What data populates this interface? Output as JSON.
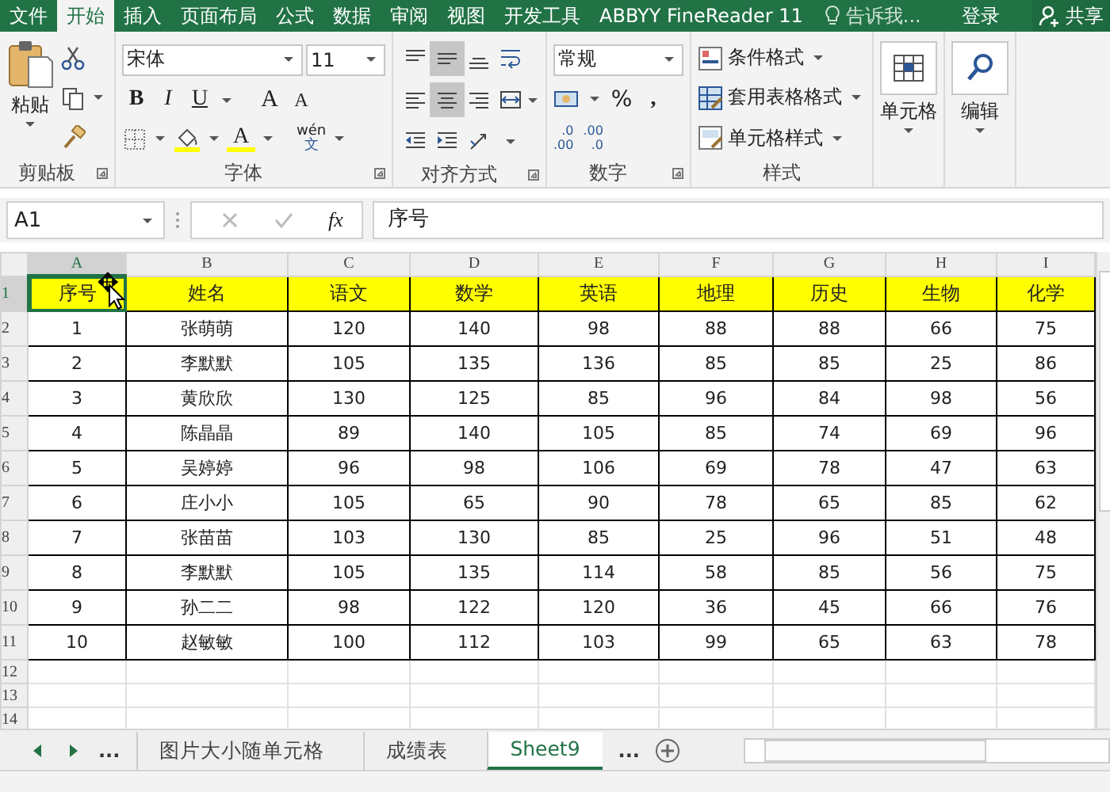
{
  "ribbon_tabs": [
    {
      "label": "文件",
      "selected": false
    },
    {
      "label": "开始",
      "selected": true
    },
    {
      "label": "插入",
      "selected": false
    },
    {
      "label": "页面布局",
      "selected": false
    },
    {
      "label": "公式",
      "selected": false
    },
    {
      "label": "数据",
      "selected": false
    },
    {
      "label": "审阅",
      "selected": false
    },
    {
      "label": "视图",
      "selected": false
    },
    {
      "label": "开发工具",
      "selected": false
    },
    {
      "label": "ABBYY FineReader 11",
      "selected": false
    }
  ],
  "tell_me": {
    "placeholder": "告诉我..."
  },
  "sign_in": "登录",
  "share": "共享",
  "ribbon": {
    "groups": [
      {
        "kind": "clipboard",
        "label": "剪贴板",
        "paste": "粘贴"
      },
      {
        "kind": "font",
        "label": "字体",
        "font_name": "宋体",
        "font_size": "11",
        "bold": "B",
        "italic": "I",
        "underline": "U",
        "grow": "A",
        "shrink": "A",
        "font_color": "A",
        "phonetic": "wén",
        "phonetic_char": "文"
      },
      {
        "kind": "alignment",
        "label": "对齐方式",
        "buttons": [
          {
            "kind": "top",
            "selected": false
          },
          {
            "kind": "middle",
            "selected": true
          },
          {
            "kind": "bottom",
            "selected": false
          },
          {
            "kind": "wrap",
            "selected": false
          },
          {
            "kind": "left",
            "selected": false
          },
          {
            "kind": "center",
            "selected": true
          },
          {
            "kind": "right",
            "selected": false
          },
          {
            "kind": "merge",
            "selected": false
          },
          {
            "kind": "outdent",
            "selected": false
          },
          {
            "kind": "indent",
            "selected": false
          },
          {
            "kind": "orientation",
            "selected": false
          }
        ]
      },
      {
        "kind": "number",
        "label": "数字",
        "format": "常规",
        "percent": "%",
        "comma": ",",
        "increase_decimal": [
          ".0",
          ".00"
        ],
        "decrease_decimal": [
          ".00",
          ".0"
        ]
      },
      {
        "kind": "styles",
        "label": "样式",
        "items": [
          "条件格式",
          "套用表格格式",
          "单元格样式"
        ]
      },
      {
        "kind": "cells",
        "button": "单元格"
      },
      {
        "kind": "editing",
        "button": "编辑"
      }
    ]
  },
  "formula_bar": {
    "name_box": "A1",
    "fx": "fx",
    "value": "序号"
  },
  "sheet": {
    "columns": [
      {
        "label": "A",
        "selected": true
      },
      {
        "label": "B",
        "selected": false
      },
      {
        "label": "C",
        "selected": false
      },
      {
        "label": "D",
        "selected": false
      },
      {
        "label": "E",
        "selected": false
      },
      {
        "label": "F",
        "selected": false
      },
      {
        "label": "G",
        "selected": false
      },
      {
        "label": "H",
        "selected": false
      },
      {
        "label": "I",
        "selected": false
      }
    ],
    "rows": [
      {
        "number": "1",
        "kind": "header",
        "selected": true,
        "cells": [
          "序号",
          "姓名",
          "语文",
          "数学",
          "英语",
          "地理",
          "历史",
          "生物",
          "化学"
        ]
      },
      {
        "number": "2",
        "kind": "data",
        "selected": false,
        "cells": [
          "1",
          "张萌萌",
          "120",
          "140",
          "98",
          "88",
          "88",
          "66",
          "75"
        ]
      },
      {
        "number": "3",
        "kind": "data",
        "selected": false,
        "cells": [
          "2",
          "李默默",
          "105",
          "135",
          "136",
          "85",
          "85",
          "25",
          "86"
        ]
      },
      {
        "number": "4",
        "kind": "data",
        "selected": false,
        "cells": [
          "3",
          "黄欣欣",
          "130",
          "125",
          "85",
          "96",
          "84",
          "98",
          "56"
        ]
      },
      {
        "number": "5",
        "kind": "data",
        "selected": false,
        "cells": [
          "4",
          "陈晶晶",
          "89",
          "140",
          "105",
          "85",
          "74",
          "69",
          "96"
        ]
      },
      {
        "number": "6",
        "kind": "data",
        "selected": false,
        "cells": [
          "5",
          "吴婷婷",
          "96",
          "98",
          "106",
          "69",
          "78",
          "47",
          "63"
        ]
      },
      {
        "number": "7",
        "kind": "data",
        "selected": false,
        "cells": [
          "6",
          "庄小小",
          "105",
          "65",
          "90",
          "78",
          "65",
          "85",
          "62"
        ]
      },
      {
        "number": "8",
        "kind": "data",
        "selected": false,
        "cells": [
          "7",
          "张苗苗",
          "103",
          "130",
          "85",
          "25",
          "96",
          "51",
          "48"
        ]
      },
      {
        "number": "9",
        "kind": "data",
        "selected": false,
        "cells": [
          "8",
          "李默默",
          "105",
          "135",
          "114",
          "58",
          "85",
          "56",
          "75"
        ]
      },
      {
        "number": "10",
        "kind": "data",
        "selected": false,
        "cells": [
          "9",
          "孙二二",
          "98",
          "122",
          "120",
          "36",
          "45",
          "66",
          "76"
        ]
      },
      {
        "number": "11",
        "kind": "data",
        "selected": false,
        "cells": [
          "10",
          "赵敏敏",
          "100",
          "112",
          "103",
          "99",
          "65",
          "63",
          "78"
        ]
      },
      {
        "number": "12",
        "kind": "empty",
        "selected": false
      },
      {
        "number": "13",
        "kind": "empty",
        "selected": false
      },
      {
        "number": "14",
        "kind": "empty",
        "selected": false
      }
    ]
  },
  "sheet_tabs": {
    "more_left": "...",
    "tabs": [
      {
        "label": "图片大小随单元格",
        "selected": false
      },
      {
        "label": "成绩表",
        "selected": false
      },
      {
        "label": "Sheet9",
        "selected": true
      }
    ],
    "more_right": "..."
  }
}
